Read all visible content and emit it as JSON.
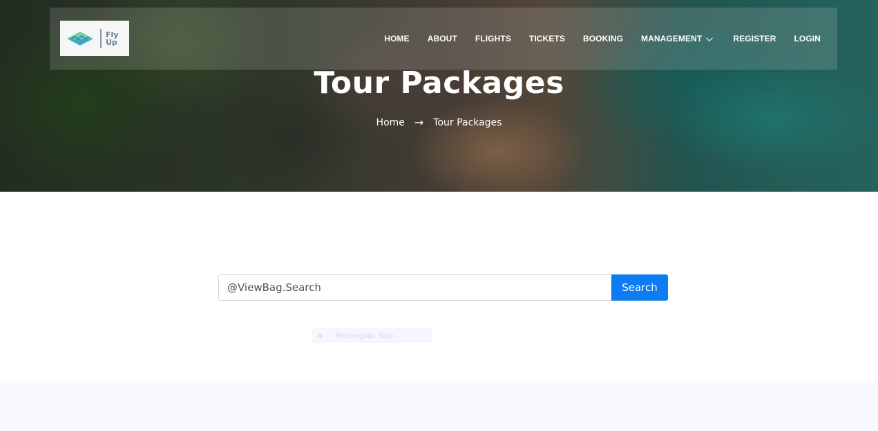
{
  "nav": {
    "logo_text_line1": "Fly",
    "logo_text_line2": "Up",
    "items": [
      {
        "label": "HOME"
      },
      {
        "label": "ABOUT"
      },
      {
        "label": "FLIGHTS"
      },
      {
        "label": "TICKETS"
      },
      {
        "label": "BOOKING"
      },
      {
        "label": "MANAGEMENT",
        "has_dropdown": true
      },
      {
        "label": "REGISTER"
      },
      {
        "label": "LOGIN"
      }
    ]
  },
  "hero": {
    "title": "Tour Packages",
    "breadcrumb": {
      "home": "Home",
      "separator": "→",
      "current": "Tour Packages"
    }
  },
  "search": {
    "value": "@ViewBag.Search",
    "button_label": "Search"
  },
  "overlay": {
    "snip_label": "Rectangular Snip"
  },
  "colors": {
    "accent": "#0d7cf2",
    "lower_band": "#f8f9fe"
  }
}
